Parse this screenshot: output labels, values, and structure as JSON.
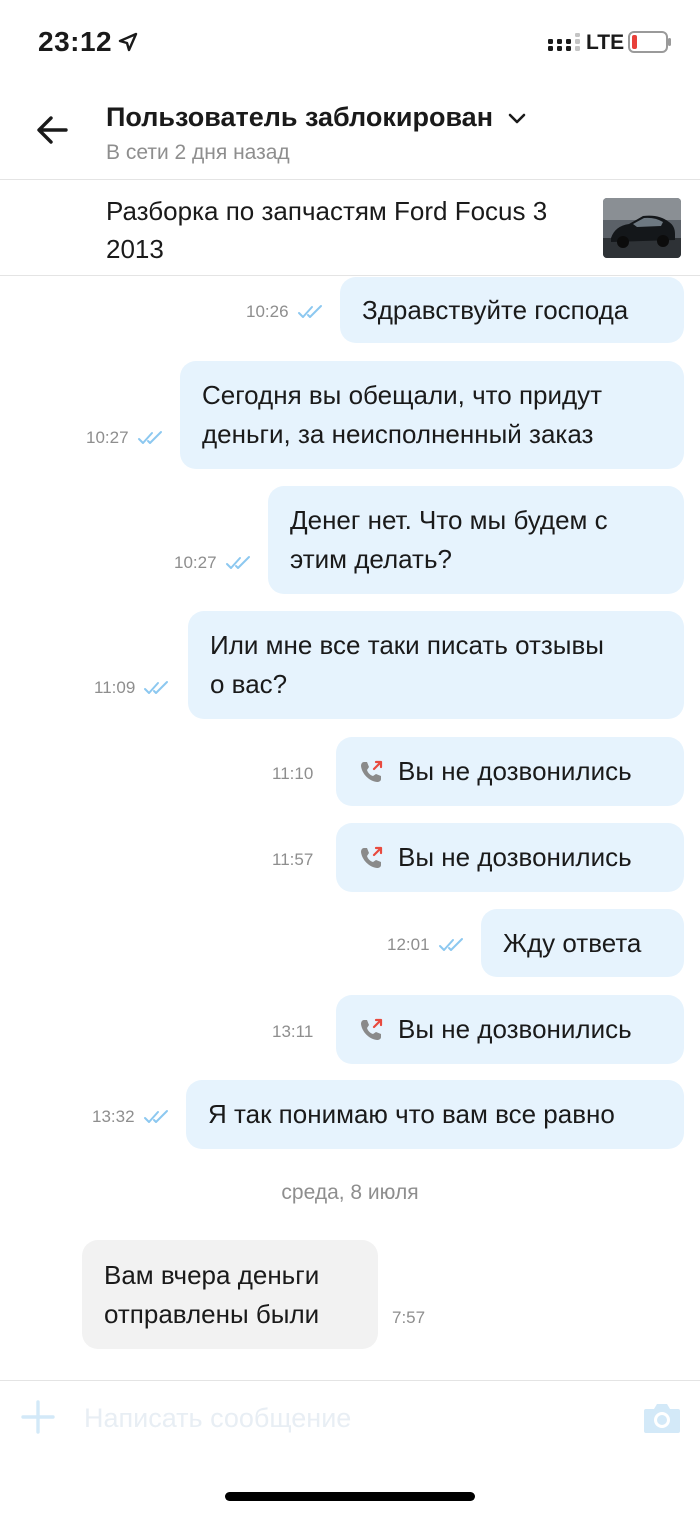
{
  "status_bar": {
    "time": "23:12",
    "network": "LTE"
  },
  "header": {
    "title": "Пользователь заблокирован",
    "subtitle": "В сети 2 дня назад"
  },
  "listing": {
    "title": "Разборка по запчастям Ford Focus 3 2013"
  },
  "messages": [
    {
      "dir": "out",
      "type": "text",
      "time": "10:26",
      "text": "Здравствуйте господа"
    },
    {
      "dir": "out",
      "type": "text",
      "time": "10:27",
      "lines": [
        "Сегодня вы обещали, что придут",
        "деньги, за неисполненный заказ"
      ]
    },
    {
      "dir": "out",
      "type": "text",
      "time": "10:27",
      "lines": [
        "Денег нет. Что мы будем с",
        "этим делать?"
      ]
    },
    {
      "dir": "out",
      "type": "text",
      "time": "11:09",
      "lines": [
        "Или мне все таки писать отзывы",
        "о вас?"
      ]
    },
    {
      "dir": "out",
      "type": "call",
      "time": "11:10",
      "text": "Вы не дозвонились"
    },
    {
      "dir": "out",
      "type": "call",
      "time": "11:57",
      "text": "Вы не дозвонились"
    },
    {
      "dir": "out",
      "type": "text",
      "time": "12:01",
      "text": "Жду ответа"
    },
    {
      "dir": "out",
      "type": "call",
      "time": "13:11",
      "text": "Вы не дозвонились"
    },
    {
      "dir": "out",
      "type": "text",
      "time": "13:32",
      "text": "Я так понимаю что вам все равно"
    },
    {
      "dir": "in",
      "type": "text",
      "time": "7:57",
      "lines": [
        "Вам вчера деньги",
        "отправлены были"
      ]
    }
  ],
  "date_separator": "среда, 8 июля",
  "composer": {
    "placeholder": "Написать сообщение"
  },
  "colors": {
    "outgoing_bubble": "#e6f3fd",
    "incoming_bubble": "#f2f2f2",
    "read_ticks": "#8cc8f0",
    "call_missed": "#e84a3f",
    "battery_low": "#e8403a"
  }
}
